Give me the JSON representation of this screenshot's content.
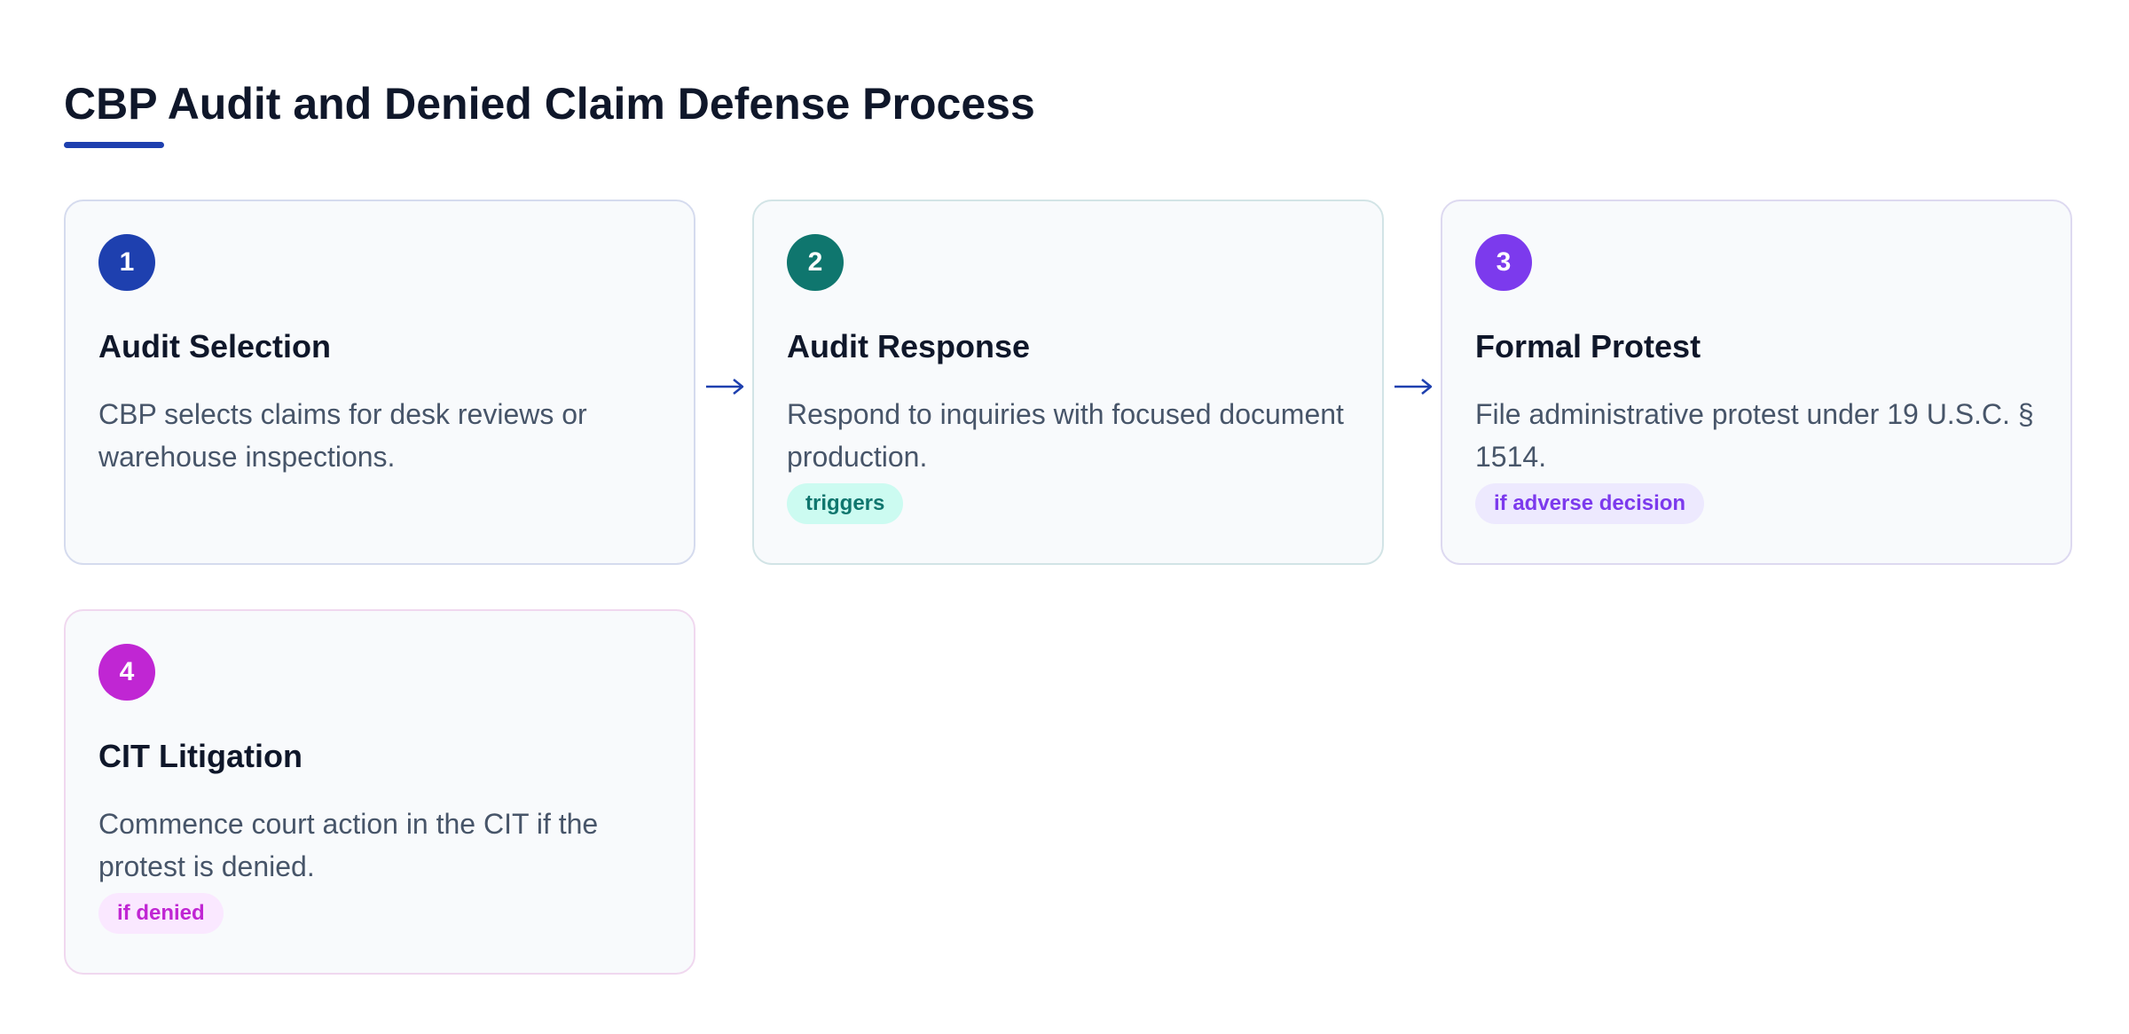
{
  "title": "CBP Audit and Denied Claim Defense Process",
  "colors": {
    "accent": "#1e40af",
    "step1": "#1e40af",
    "step2": "#0f766e",
    "step3": "#7c3aed",
    "step4": "#c026d3"
  },
  "steps": [
    {
      "number": "1",
      "title": "Audit Selection",
      "text": "CBP selects claims for desk reviews or warehouse inspections."
    },
    {
      "number": "2",
      "title": "Audit Response",
      "text": "Respond to inquiries with focused document production.",
      "tag": "triggers"
    },
    {
      "number": "3",
      "title": "Formal Protest",
      "text": "File administrative protest under 19 U.S.C. § 1514.",
      "tag": "if adverse decision"
    },
    {
      "number": "4",
      "title": "CIT Litigation",
      "text": "Commence court action in the CIT if the protest is denied.",
      "tag": "if denied"
    }
  ]
}
